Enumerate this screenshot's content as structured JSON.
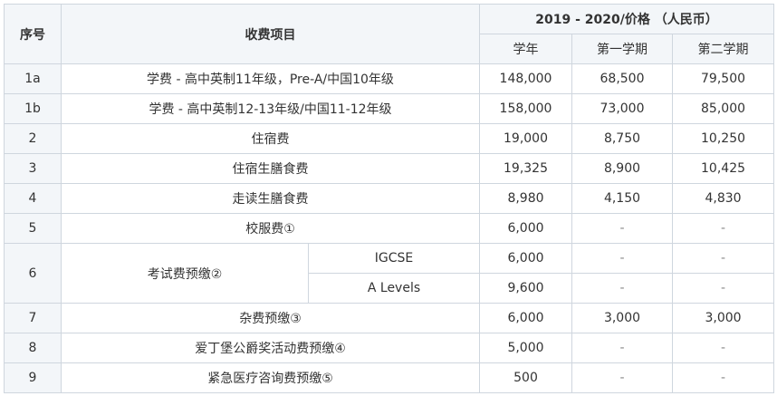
{
  "header": {
    "col_index": "序号",
    "col_item": "收费项目",
    "col_price_group": "2019 - 2020/价格 （人民币）",
    "col_year": "学年",
    "col_term1": "第一学期",
    "col_term2": "第二学期"
  },
  "rows": [
    {
      "idx": "1a",
      "item": "学费 - 高中英制11年级，Pre-A/中国10年级",
      "year": "148,000",
      "term1": "68,500",
      "term2": "79,500"
    },
    {
      "idx": "1b",
      "item": "学费 - 高中英制12-13年级/中国11-12年级",
      "year": "158,000",
      "term1": "73,000",
      "term2": "85,000"
    },
    {
      "idx": "2",
      "item": "住宿费",
      "year": "19,000",
      "term1": "8,750",
      "term2": "10,250"
    },
    {
      "idx": "3",
      "item": "住宿生膳食费",
      "year": "19,325",
      "term1": "8,900",
      "term2": "10,425"
    },
    {
      "idx": "4",
      "item": "走读生膳食费",
      "year": "8,980",
      "term1": "4,150",
      "term2": "4,830"
    },
    {
      "idx": "5",
      "item": "校服费①",
      "year": "6,000",
      "term1": "-",
      "term2": "-"
    },
    {
      "idx": "6",
      "item": "考试费预缴②",
      "sub1": "IGCSE",
      "year1": "6,000",
      "term1_1": "-",
      "term2_1": "-",
      "sub2": "A Levels",
      "year2": "9,600",
      "term1_2": "-",
      "term2_2": "-"
    },
    {
      "idx": "7",
      "item": "杂费预缴③",
      "year": "6,000",
      "term1": "3,000",
      "term2": "3,000"
    },
    {
      "idx": "8",
      "item": "爱丁堡公爵奖活动费预缴④",
      "year": "5,000",
      "term1": "-",
      "term2": "-"
    },
    {
      "idx": "9",
      "item": "紧急医疗咨询费预缴⑤",
      "year": "500",
      "term1": "-",
      "term2": "-"
    }
  ]
}
